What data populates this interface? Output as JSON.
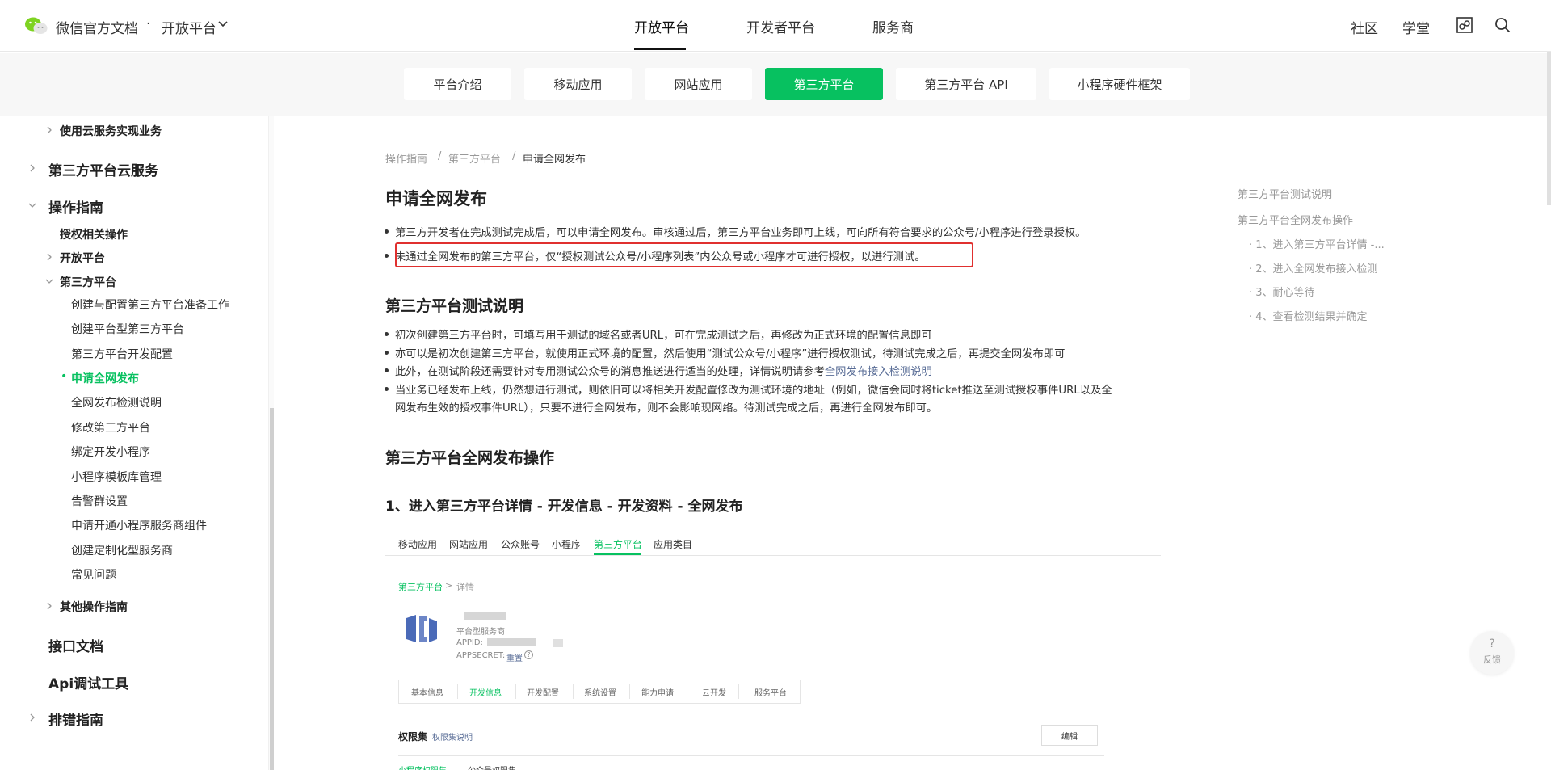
{
  "header": {
    "brand": "微信官方文档",
    "brand_dot": "·",
    "brand_sub": "开放平台",
    "nav": [
      "开放平台",
      "开发者平台",
      "服务商"
    ],
    "right_links": [
      "社区",
      "学堂"
    ]
  },
  "subnav": [
    "平台介绍",
    "移动应用",
    "网站应用",
    "第三方平台",
    "第三方平台 API",
    "小程序硬件框架"
  ],
  "sidebar": {
    "items": [
      "使用云服务实现业务",
      "第三方平台云服务",
      "操作指南",
      "授权相关操作",
      "开放平台",
      "第三方平台",
      "创建与配置第三方平台准备工作",
      "创建平台型第三方平台",
      "第三方平台开发配置",
      "申请全网发布",
      "全网发布检测说明",
      "修改第三方平台",
      "绑定开发小程序",
      "小程序模板库管理",
      "告警群设置",
      "申请开通小程序服务商组件",
      "创建定制化型服务商",
      "常见问题",
      "其他操作指南",
      "接口文档",
      "Api调试工具",
      "排错指南"
    ]
  },
  "breadcrumb": [
    "操作指南",
    "/",
    "第三方平台",
    "/",
    "申请全网发布"
  ],
  "content": {
    "title": "申请全网发布",
    "intro": [
      "第三方开发者在完成测试完成后，可以申请全网发布。审核通过后，第三方平台业务即可上线，可向所有符合要求的公众号/小程序进行登录授权。",
      "未通过全网发布的第三方平台，仅“授权测试公众号/小程序列表”内公众号或小程序才可进行授权，以进行测试。"
    ],
    "section1_title": "第三方平台测试说明",
    "section1": [
      "初次创建第三方平台时，可填写用于测试的域名或者URL，可在完成测试之后，再修改为正式环境的配置信息即可",
      "亦可以是初次创建第三方平台，就使用正式环境的配置，然后使用“测试公众号/小程序”进行授权测试，待测试完成之后，再提交全网发布即可",
      "此外，在测试阶段还需要针对专用测试公众号的消息推送进行适当的处理，详情说明请参考",
      "全网发布接入检测说明",
      "当业务已经发布上线，仍然想进行测试，则依旧可以将相关开发配置修改为测试环境的地址（例如，微信会同时将ticket推送至测试授权事件URL以及全",
      "网发布生效的授权事件URL），只要不进行全网发布，则不会影响现网络。待测试完成之后，再进行全网发布即可。"
    ],
    "section2_title": "第三方平台全网发布操作",
    "step1_title": "1、进入第三方平台详情 - 开发信息 - 开发资料 - 全网发布"
  },
  "embedded": {
    "tabs": [
      "移动应用",
      "网站应用",
      "公众账号",
      "小程序",
      "第三方平台",
      "应用类目"
    ],
    "crumb": [
      "第三方平台",
      ">",
      "详情"
    ],
    "type": "平台型服务商",
    "appid_label": "APPID:",
    "appsecret_label": "APPSECRET:",
    "reset": "重置",
    "help": "?",
    "tabs2": [
      "基本信息",
      "开发信息",
      "开发配置",
      "系统设置",
      "能力申请",
      "云开发",
      "服务平台"
    ],
    "perm": "权限集",
    "perm_link": "权限集说明",
    "edit": "编辑",
    "bottom": [
      "小程序权限集",
      "公众号权限集"
    ]
  },
  "toc": [
    "第三方平台测试说明",
    "第三方平台全网发布操作",
    "· 1、进入第三方平台详情 -...",
    "· 2、进入全网发布接入检测",
    "· 3、耐心等待",
    "· 4、查看检测结果并确定"
  ],
  "feedback": {
    "q": "?",
    "label": "反馈"
  },
  "colors": {
    "accent": "#07c160",
    "link": "#576b95",
    "highlight_border": "#e0302f"
  }
}
